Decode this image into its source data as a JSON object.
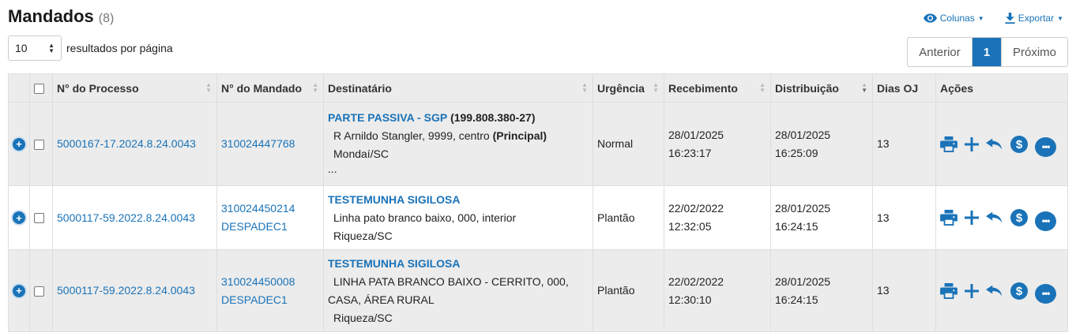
{
  "header": {
    "title": "Mandados",
    "count": "(8)"
  },
  "toolbar": {
    "columns_label": "Colunas",
    "export_label": "Exportar"
  },
  "page_size": {
    "value": "10",
    "label": "resultados por página"
  },
  "pagination": {
    "prev": "Anterior",
    "current": "1",
    "next": "Próximo"
  },
  "table": {
    "headers": {
      "processo": "N° do Processo",
      "mandado": "N° do Mandado",
      "destinatario": "Destinatário",
      "urgencia": "Urgência",
      "recebimento": "Recebimento",
      "distribuicao": "Distribuição",
      "dias": "Dias OJ",
      "acoes": "Ações"
    },
    "rows": [
      {
        "processo": "5000167-17.2024.8.24.0043",
        "mandado": "310024447768",
        "mandado_sub": "",
        "dest_name": "PARTE PASSIVA - SGP",
        "dest_cpf": "(199.808.380-27)",
        "addr1": "R Arnildo Stangler, 9999, centro",
        "addr1_tag": "(Principal)",
        "addr2": "",
        "city": "Mondaí/SC",
        "ellipsis": "...",
        "urgencia": "Normal",
        "rec_date": "28/01/2025",
        "rec_time": "16:23:17",
        "dist_date": "28/01/2025",
        "dist_time": "16:25:09",
        "dias": "13"
      },
      {
        "processo": "5000117-59.2022.8.24.0043",
        "mandado": "310024450214",
        "mandado_sub": "DESPADEC1",
        "dest_name": "TESTEMUNHA SIGILOSA",
        "dest_cpf": "",
        "addr1": "Linha pato branco baixo, 000, interior",
        "addr1_tag": "",
        "addr2": "",
        "city": "Riqueza/SC",
        "ellipsis": "",
        "urgencia": "Plantão",
        "rec_date": "22/02/2022",
        "rec_time": "12:32:05",
        "dist_date": "28/01/2025",
        "dist_time": "16:24:15",
        "dias": "13"
      },
      {
        "processo": "5000117-59.2022.8.24.0043",
        "mandado": "310024450008",
        "mandado_sub": "DESPADEC1",
        "dest_name": "TESTEMUNHA SIGILOSA",
        "dest_cpf": "",
        "addr1": "LINHA PATA BRANCO BAIXO - CERRITO, 000,",
        "addr1_tag": "",
        "addr2": "CASA, ÁREA RURAL",
        "city": "Riqueza/SC",
        "ellipsis": "",
        "urgencia": "Plantão",
        "rec_date": "22/02/2022",
        "rec_time": "12:30:10",
        "dist_date": "28/01/2025",
        "dist_time": "16:24:15",
        "dias": "13"
      }
    ]
  },
  "colors": {
    "accent": "#1a73b8",
    "row_shade": "#ececec"
  }
}
